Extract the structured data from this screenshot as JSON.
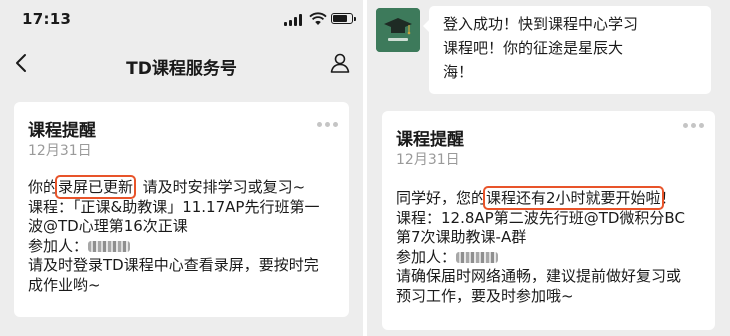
{
  "left": {
    "status": {
      "time": "17:13"
    },
    "nav": {
      "title": "TD课程服务号"
    },
    "card": {
      "title": "课程提醒",
      "date": "12月31日",
      "line1_prefix": "你的",
      "line1_highlight": "录屏已更新",
      "line1_suffix": "  请及时安排学习或复习~",
      "line2": "课程：「正课&助教课」11.17AP先行班第一",
      "line3": "波@TD心理第16次正课",
      "line4_label": "参加人：",
      "line5": "请及时登录TD课程中心查看录屏，要按时完",
      "line6": "成作业哟~"
    }
  },
  "right": {
    "chat": {
      "bubble_line1": "登入成功！快到课程中心学习",
      "bubble_line2": "课程吧！你的征途是星辰大",
      "bubble_line3": "海！"
    },
    "card": {
      "title": "课程提醒",
      "date": "12月31日",
      "line1_prefix": "同学好，您的",
      "line1_highlight": "课程还有2小时就要开始啦",
      "line1_suffix": "！",
      "line2": "课程：12.8AP第二波先行班@TD微积分BC",
      "line3": "第7次课助教课-A群",
      "line4_label": "参加人：",
      "line5": "请确保届时网络通畅，建议提前做好复习或",
      "line6": "预习工作，要及时参加哦~"
    }
  },
  "icons": {
    "back": "chevron-left-icon",
    "profile": "person-icon",
    "more": "more-dots-icon"
  },
  "colors": {
    "highlight": "#e8542a",
    "background": "#ededed",
    "avatar": "#3d7a5b"
  }
}
